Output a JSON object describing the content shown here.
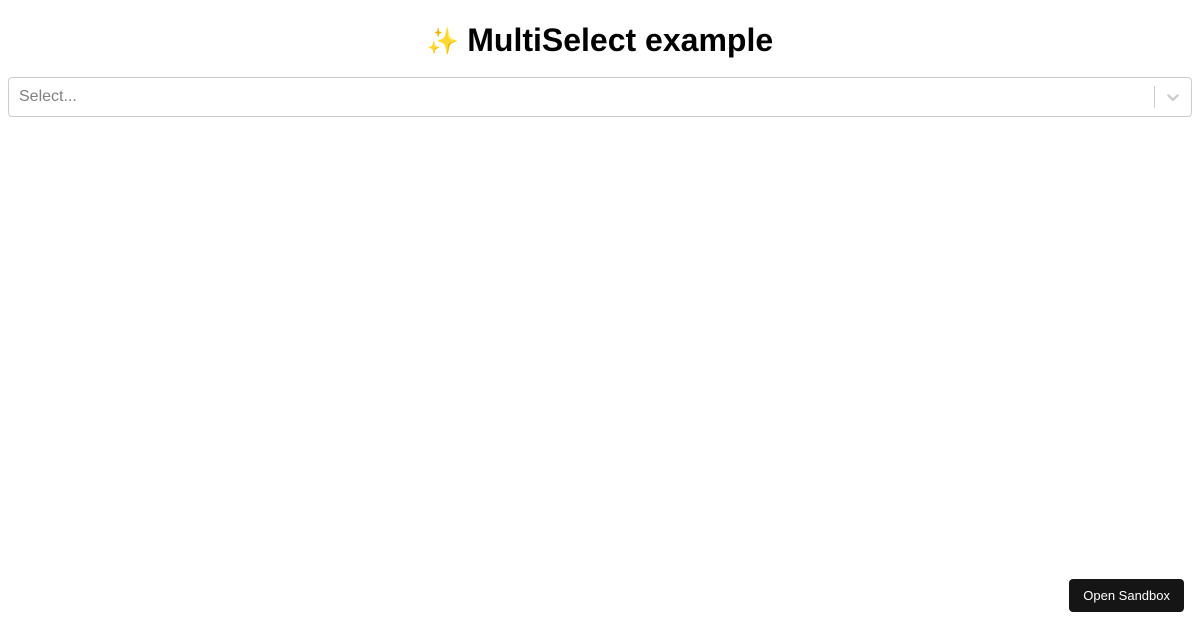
{
  "header": {
    "title": "MultiSelect example",
    "icon": "sparkle-stars-icon",
    "icon_glyph": "✨"
  },
  "select": {
    "placeholder": "Select...",
    "value": "",
    "options": []
  },
  "footer": {
    "open_sandbox_label": "Open Sandbox"
  },
  "colors": {
    "border": "#cccccc",
    "placeholder": "#808080",
    "button_bg": "#151515",
    "button_text": "#ffffff"
  }
}
